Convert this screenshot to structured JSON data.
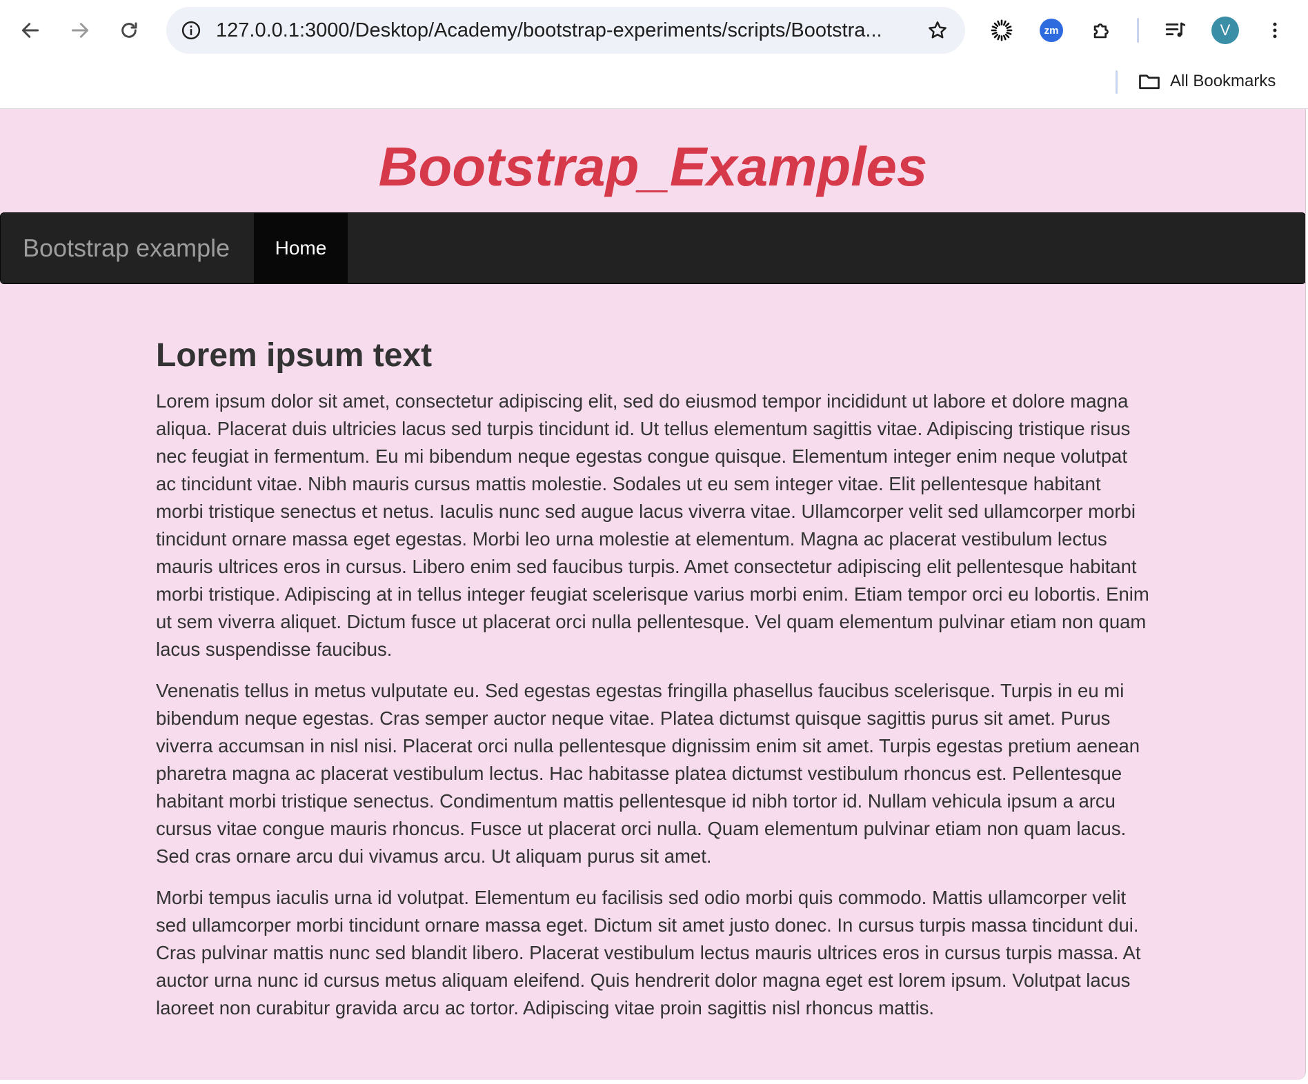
{
  "browser": {
    "url": "127.0.0.1:3000/Desktop/Academy/bootstrap-experiments/scripts/Bootstra...",
    "bookmarks_label": "All Bookmarks",
    "profile_initial": "V",
    "zoom_ext_label": "zm"
  },
  "page": {
    "site_title": "Bootstrap_Examples",
    "navbar": {
      "brand": "Bootstrap example",
      "items": [
        "Home"
      ]
    },
    "heading": "Lorem ipsum text",
    "paragraphs": [
      "Lorem ipsum dolor sit amet, consectetur adipiscing elit, sed do eiusmod tempor incididunt ut labore et dolore magna aliqua. Placerat duis ultricies lacus sed turpis tincidunt id. Ut tellus elementum sagittis vitae. Adipiscing tristique risus nec feugiat in fermentum. Eu mi bibendum neque egestas congue quisque. Elementum integer enim neque volutpat ac tincidunt vitae. Nibh mauris cursus mattis molestie. Sodales ut eu sem integer vitae. Elit pellentesque habitant morbi tristique senectus et netus. Iaculis nunc sed augue lacus viverra vitae. Ullamcorper velit sed ullamcorper morbi tincidunt ornare massa eget egestas. Morbi leo urna molestie at elementum. Magna ac placerat vestibulum lectus mauris ultrices eros in cursus. Libero enim sed faucibus turpis. Amet consectetur adipiscing elit pellentesque habitant morbi tristique. Adipiscing at in tellus integer feugiat scelerisque varius morbi enim. Etiam tempor orci eu lobortis. Enim ut sem viverra aliquet. Dictum fusce ut placerat orci nulla pellentesque. Vel quam elementum pulvinar etiam non quam lacus suspendisse faucibus.",
      "Venenatis tellus in metus vulputate eu. Sed egestas egestas fringilla phasellus faucibus scelerisque. Turpis in eu mi bibendum neque egestas. Cras semper auctor neque vitae. Platea dictumst quisque sagittis purus sit amet. Purus viverra accumsan in nisl nisi. Placerat orci nulla pellentesque dignissim enim sit amet. Turpis egestas pretium aenean pharetra magna ac placerat vestibulum lectus. Hac habitasse platea dictumst vestibulum rhoncus est. Pellentesque habitant morbi tristique senectus. Condimentum mattis pellentesque id nibh tortor id. Nullam vehicula ipsum a arcu cursus vitae congue mauris rhoncus. Fusce ut placerat orci nulla. Quam elementum pulvinar etiam non quam lacus. Sed cras ornare arcu dui vivamus arcu. Ut aliquam purus sit amet.",
      "Morbi tempus iaculis urna id volutpat. Elementum eu facilisis sed odio morbi quis commodo. Mattis ullamcorper velit sed ullamcorper morbi tincidunt ornare massa eget. Dictum sit amet justo donec. In cursus turpis massa tincidunt dui. Cras pulvinar mattis nunc sed blandit libero. Placerat vestibulum lectus mauris ultrices eros in cursus turpis massa. At auctor urna nunc id cursus metus aliquam eleifend. Quis hendrerit dolor magna eget est lorem ipsum. Volutpat lacus laoreet non curabitur gravida arcu ac tortor. Adipiscing vitae proin sagittis nisl rhoncus mattis."
    ]
  },
  "colors": {
    "page_background": "#f6dced",
    "title": "#d63a4a",
    "navbar": "#222222",
    "navbar_active": "#080808",
    "text": "#333333"
  },
  "icons": [
    "back-arrow-icon",
    "forward-arrow-icon",
    "reload-icon",
    "site-info-icon",
    "bookmark-star-icon",
    "extension-sun-icon",
    "zoom-extension-icon",
    "extensions-puzzle-icon",
    "media-controls-icon",
    "profile-avatar",
    "menu-kebab-icon",
    "folder-icon"
  ]
}
